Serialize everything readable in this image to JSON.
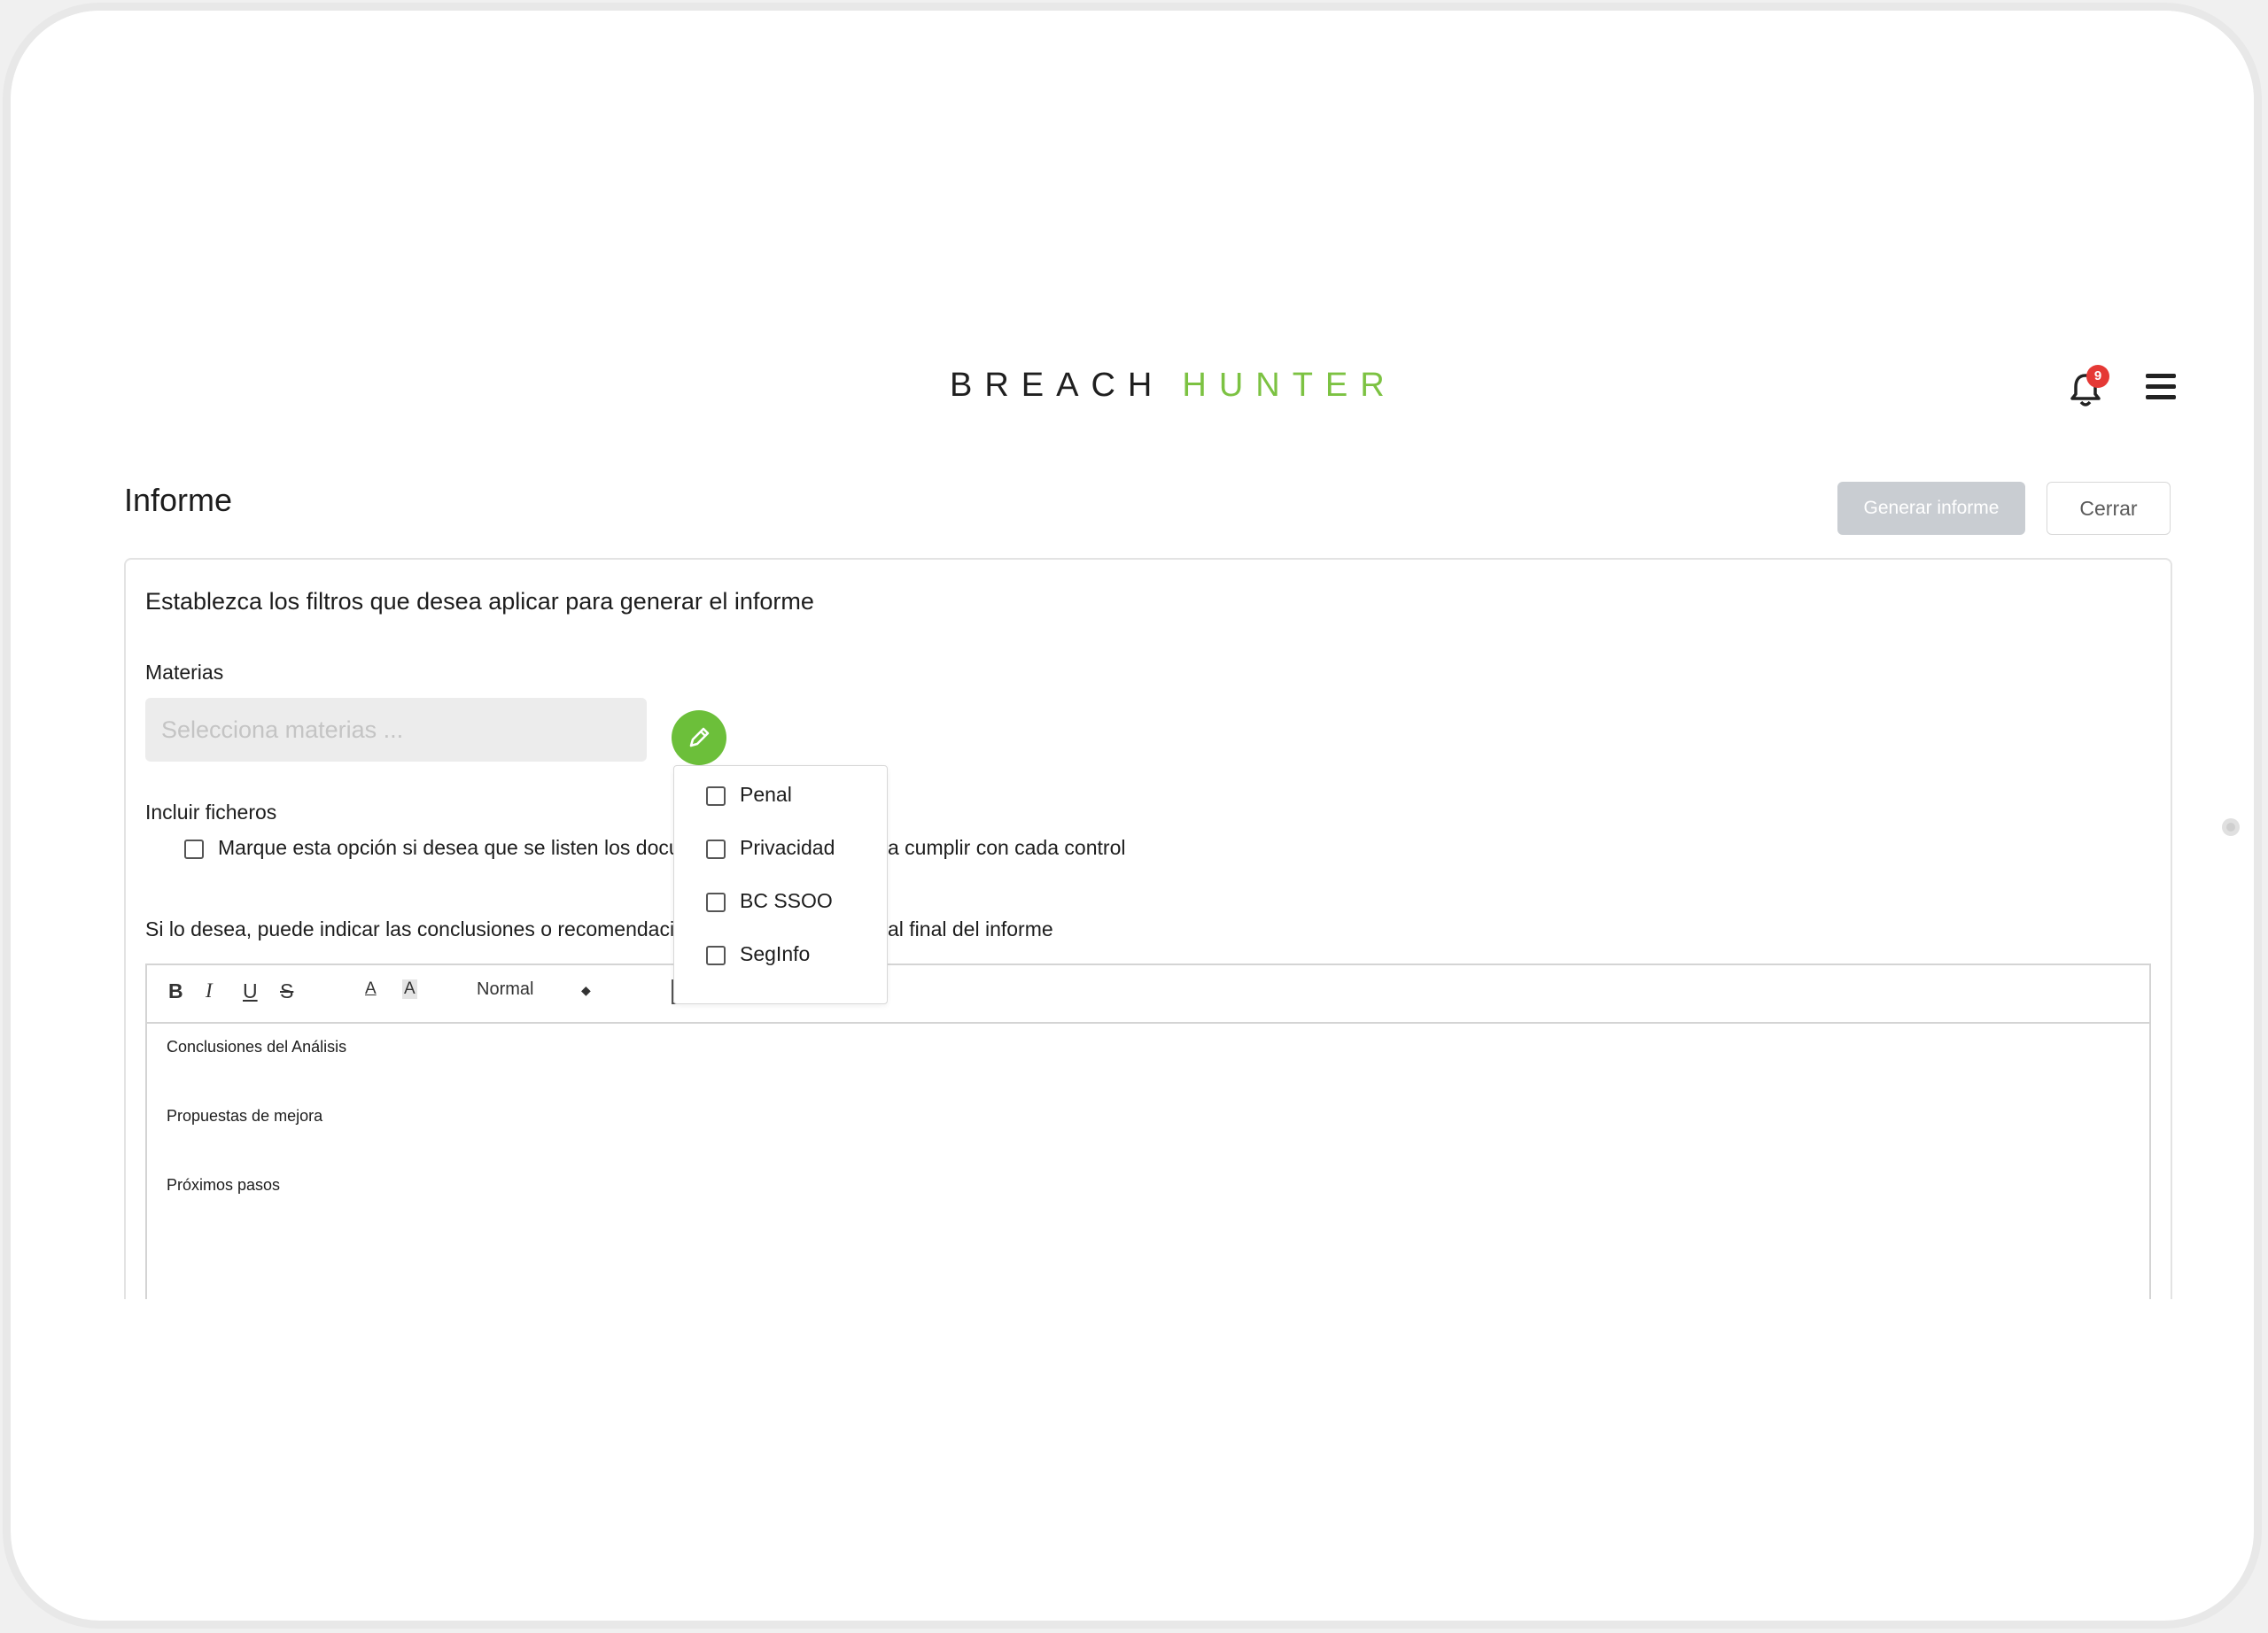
{
  "brand": {
    "part1": "BREACH",
    "part2": "HUNTER",
    "accent": "#7cc242"
  },
  "header": {
    "notifications_count": "9",
    "bell_icon": "bell-icon",
    "menu_icon": "hamburger-menu-icon"
  },
  "page": {
    "title": "Informe"
  },
  "actions": {
    "generate_label": "Generar informe",
    "close_label": "Cerrar"
  },
  "filters": {
    "title": "Establezca los filtros que desea aplicar para generar el informe",
    "materias_label": "Materias",
    "materias_placeholder": "Selecciona materias ...",
    "edit_icon": "pencil-icon",
    "include_files_label": "Incluir ficheros",
    "include_files_text_left": "Marque esta opción si desea que se listen los docu",
    "include_files_text_right": "a cumplir con cada control",
    "conclusions_text_left": "Si lo desea, puede indicar las conclusiones o recomendaci",
    "conclusions_text_right": "al final del informe"
  },
  "dropdown": {
    "options": [
      {
        "label": "Penal",
        "checked": false
      },
      {
        "label": "Privacidad",
        "checked": false
      },
      {
        "label": "BC SSOO",
        "checked": false
      },
      {
        "label": "SegInfo",
        "checked": false
      }
    ]
  },
  "editor": {
    "toolbar": {
      "bold": "B",
      "italic": "I",
      "underline": "U",
      "strike": "S",
      "font_color": "A",
      "highlight": "A",
      "format": "Normal"
    },
    "lines": [
      "Conclusiones del Análisis",
      "Propuestas de mejora",
      "Próximos pasos"
    ]
  }
}
